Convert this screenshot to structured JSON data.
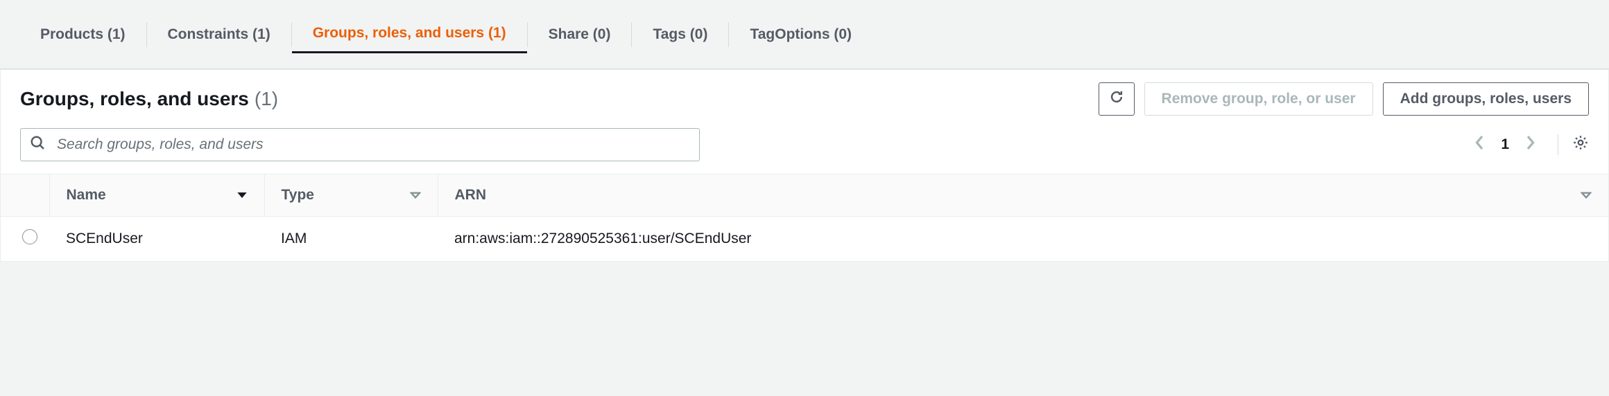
{
  "tabs": [
    {
      "label": "Products (1)",
      "active": false
    },
    {
      "label": "Constraints (1)",
      "active": false
    },
    {
      "label": "Groups, roles, and users (1)",
      "active": true
    },
    {
      "label": "Share (0)",
      "active": false
    },
    {
      "label": "Tags (0)",
      "active": false
    },
    {
      "label": "TagOptions (0)",
      "active": false
    }
  ],
  "panel": {
    "title": "Groups, roles, and users",
    "count": "(1)"
  },
  "actions": {
    "remove": "Remove group, role, or user",
    "add": "Add groups, roles, users"
  },
  "search": {
    "placeholder": "Search groups, roles, and users"
  },
  "pagination": {
    "page": "1"
  },
  "table": {
    "columns": {
      "name": "Name",
      "type": "Type",
      "arn": "ARN"
    },
    "rows": [
      {
        "name": "SCEndUser",
        "type": "IAM",
        "arn": "arn:aws:iam::272890525361:user/SCEndUser"
      }
    ]
  }
}
